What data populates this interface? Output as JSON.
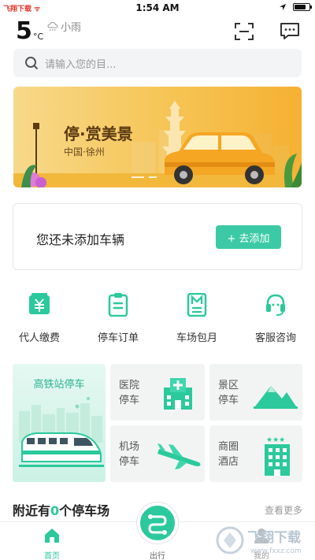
{
  "status_bar": {
    "carrier": "飞翔下载 ᯤ",
    "time": "1:54 AM",
    "icons": [
      "location-arrow-icon",
      "battery-icon"
    ],
    "battery_level": 0.8
  },
  "header": {
    "temperature": "5",
    "temperature_unit": "°C",
    "weather_text": "小雨",
    "weather_icon": "rain-cloud-icon",
    "scan_icon": "scan-icon",
    "message_icon": "message-icon"
  },
  "search": {
    "placeholder": "请输入您的目..."
  },
  "banner": {
    "title": "停·赏美景",
    "subtitle": "中国·徐州"
  },
  "vehicle": {
    "empty_text": "您还未添加车辆",
    "add_button": "+  去添加"
  },
  "services": [
    {
      "label": "代人缴费",
      "icon": "yuan-payment-icon"
    },
    {
      "label": "停车订单",
      "icon": "order-list-icon"
    },
    {
      "label": "车场包月",
      "icon": "monthly-calendar-icon"
    },
    {
      "label": "客服咨询",
      "icon": "headset-icon"
    }
  ],
  "parking_tiles": {
    "featured": {
      "label": "高铁站停车",
      "icon": "high-speed-train-icon"
    },
    "hospital": {
      "line1": "医院",
      "line2": "停车",
      "icon": "hospital-icon"
    },
    "scenic": {
      "line1": "景区",
      "line2": "停车",
      "icon": "mountain-icon"
    },
    "airport": {
      "line1": "机场",
      "line2": "停车",
      "icon": "airplane-icon"
    },
    "mall": {
      "line1": "商圈",
      "line2": "酒店",
      "icon": "hotel-icon"
    }
  },
  "nearby": {
    "prefix": "附近有",
    "count": "0",
    "suffix": "个停车场",
    "more": "查看更多"
  },
  "bottom_nav": {
    "home": "首页",
    "travel": "出行",
    "mine": "我的"
  },
  "watermark": {
    "brand": "飞翔下载",
    "url": "www.fxxz.com"
  },
  "colors": {
    "accent": "#2bc99b",
    "button": "#3ccaa6",
    "banner": "#f6c454"
  }
}
